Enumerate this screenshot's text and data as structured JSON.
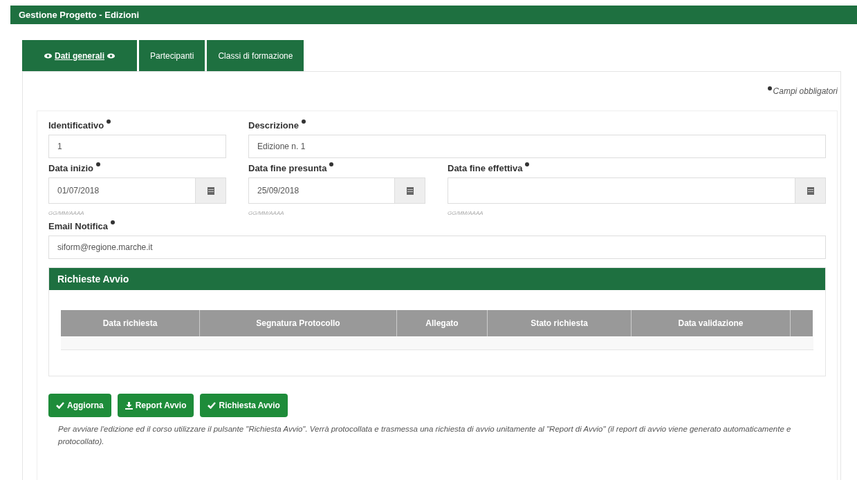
{
  "header": {
    "title": "Gestione Progetto - Edizioni"
  },
  "tabs": [
    {
      "label": "Dati generali",
      "selected": true
    },
    {
      "label": "Partecipanti",
      "selected": false
    },
    {
      "label": "Classi di formazione",
      "selected": false
    }
  ],
  "required_note": "Campi obbligatori",
  "fields": [
    {
      "label": "Identificativo",
      "required": true,
      "value": "1",
      "kind": "text"
    },
    {
      "label": "Descrizione",
      "required": true,
      "value": "Edizione n. 1",
      "kind": "text"
    },
    {
      "label": "Data inizio",
      "required": true,
      "value": "01/07/2018",
      "kind": "date",
      "hint": "GG/MM/AAAA"
    },
    {
      "label": "Data fine presunta",
      "required": true,
      "value": "25/09/2018",
      "kind": "date",
      "hint": "GG/MM/AAAA"
    },
    {
      "label": "Data fine effettiva",
      "required": true,
      "kind": "date",
      "hint": "GG/MM/AAAA"
    },
    {
      "label": "Email Notifica",
      "required": true,
      "value": "siform@regione.marche.it",
      "kind": "text"
    }
  ],
  "requests": {
    "title": "Richieste Avvio",
    "table": {
      "columns": [
        "Data richiesta",
        "Segnatura Protocollo",
        "Allegato",
        "Stato richiesta",
        "Data validazione"
      ]
    }
  },
  "buttons": [
    {
      "label": "Aggiorna",
      "kind": "check"
    },
    {
      "label": "Report Avvio",
      "kind": "download"
    },
    {
      "label": "Richiesta Avvio",
      "kind": "check"
    }
  ],
  "note": "Per avviare l'edizione ed il corso utilizzare il pulsante \"Richiesta Avvio\". Verrà protocollata e trasmessa una richiesta di avvio unitamente al \"Report di Avvio\" (il report di avvio viene generato automaticamente e protocollato)."
}
